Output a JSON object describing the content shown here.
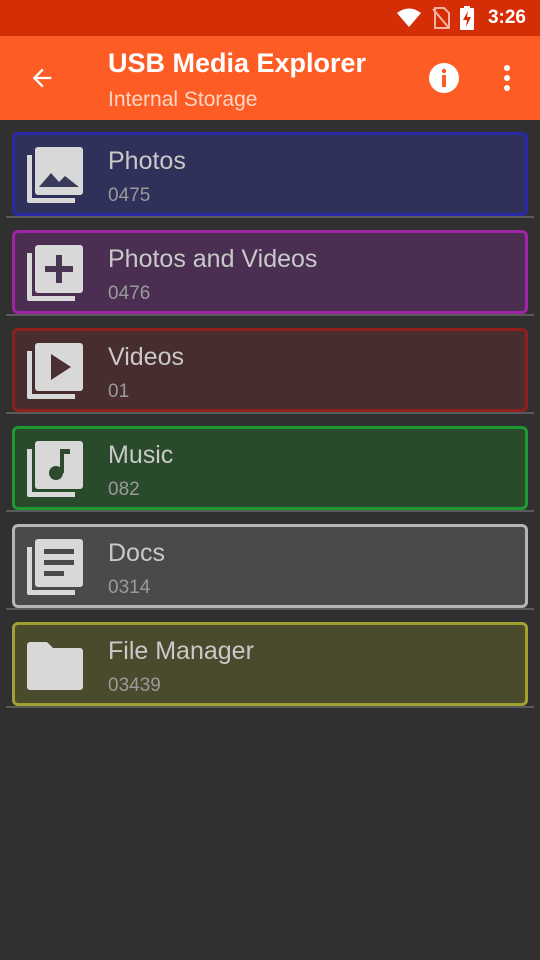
{
  "status_bar": {
    "time": "3:26"
  },
  "app_bar": {
    "title": "USB Media Explorer",
    "subtitle": "Internal Storage"
  },
  "colors": {
    "status_bar": "#d52d05",
    "app_bar": "#fd5c25",
    "background": "#303030"
  },
  "items": [
    {
      "label": "Photos",
      "count": "0475",
      "icon": "photo-library-icon",
      "border": "#2a2aa8",
      "fill": "#30315a"
    },
    {
      "label": "Photos and Videos",
      "count": "0476",
      "icon": "add-to-library-icon",
      "border": "#a024a8",
      "fill": "#4a2f52"
    },
    {
      "label": "Videos",
      "count": "01",
      "icon": "video-library-icon",
      "border": "#8e1f1f",
      "fill": "#472d2d"
    },
    {
      "label": "Music",
      "count": "082",
      "icon": "music-library-icon",
      "border": "#1d9a2f",
      "fill": "#2a4a2c"
    },
    {
      "label": "Docs",
      "count": "0314",
      "icon": "document-library-icon",
      "border": "#b5b5b5",
      "fill": "#4a4a4a"
    },
    {
      "label": "File Manager",
      "count": "03439",
      "icon": "folder-icon",
      "border": "#a2a030",
      "fill": "#4a4a2c"
    }
  ]
}
